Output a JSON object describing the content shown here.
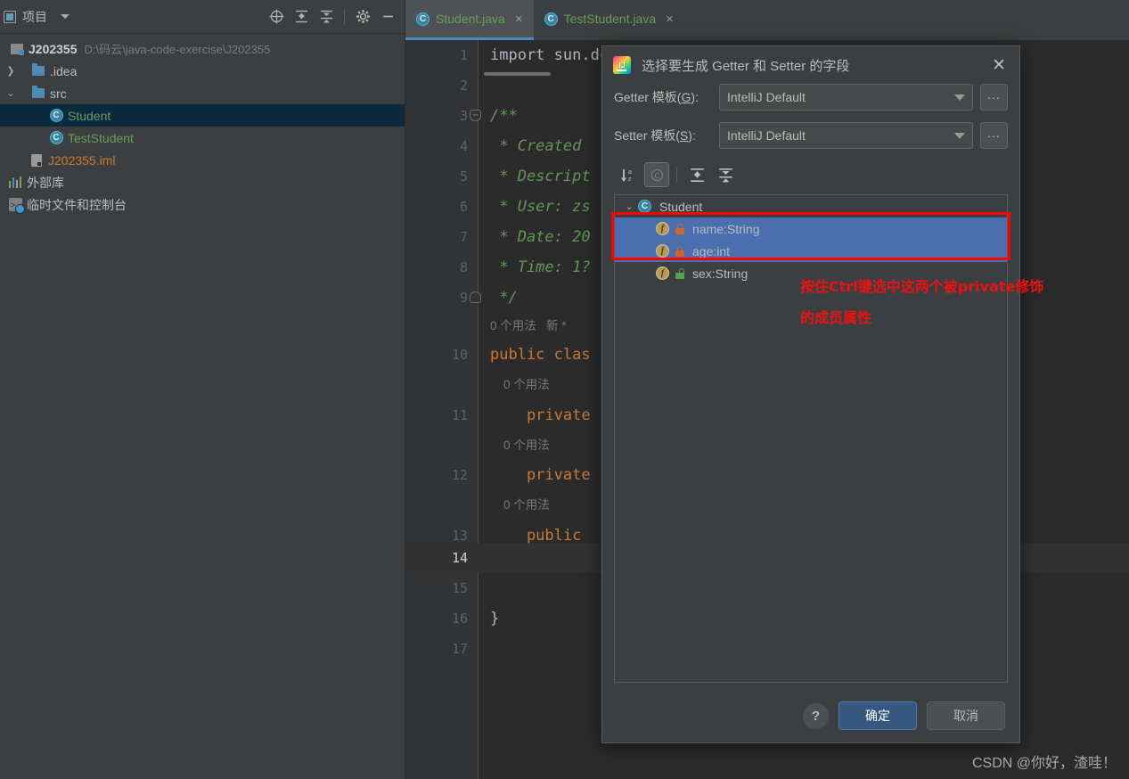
{
  "project_panel": {
    "title": "项目",
    "icons": {
      "project_icon": "project-view-icon",
      "dropdown": "chevron-down-icon",
      "locate": "crosshair-target-icon",
      "expand_all": "expand-all-icon",
      "collapse_all": "collapse-all-icon",
      "settings": "gear-icon",
      "hide": "minimize-icon"
    },
    "tree": [
      {
        "label": "J202355",
        "path": "D:\\码云\\java-code-exercise\\J202355",
        "icon": "module-icon",
        "indent": 0,
        "twist": "",
        "bold": true,
        "color": "normal",
        "selected": false
      },
      {
        "label": ".idea",
        "path": "",
        "icon": "folder-icon",
        "indent": 1,
        "twist": "collapsed",
        "bold": false,
        "color": "normal",
        "selected": false
      },
      {
        "label": "src",
        "path": "",
        "icon": "folder-icon",
        "indent": 1,
        "twist": "expanded",
        "bold": false,
        "color": "normal",
        "selected": false
      },
      {
        "label": "Student",
        "path": "",
        "icon": "java-class-icon",
        "indent": 2,
        "twist": "",
        "bold": false,
        "color": "green",
        "selected": true
      },
      {
        "label": "TestStudent",
        "path": "",
        "icon": "java-class-icon",
        "indent": 2,
        "twist": "",
        "bold": false,
        "color": "green",
        "selected": false
      },
      {
        "label": "J202355.iml",
        "path": "",
        "icon": "iml-file-icon",
        "indent": 1,
        "twist": "",
        "bold": false,
        "color": "red",
        "selected": false
      },
      {
        "label": "外部库",
        "path": "",
        "icon": "external-libraries-icon",
        "indent": 0,
        "twist": "",
        "bold": false,
        "color": "normal",
        "selected": false
      },
      {
        "label": "临时文件和控制台",
        "path": "",
        "icon": "scratches-consoles-icon",
        "indent": 0,
        "twist": "",
        "bold": false,
        "color": "normal",
        "selected": false
      }
    ]
  },
  "editor": {
    "tabs": [
      {
        "label": "Student.java",
        "active": true,
        "icon": "java-class-icon",
        "close": "×"
      },
      {
        "label": "TestStudent.java",
        "active": false,
        "icon": "java-class-icon",
        "close": "×"
      }
    ],
    "current_line": 14,
    "lines": [
      {
        "no": "1",
        "text": "import sun.dc.pr.Rasterizer;",
        "style": "plain",
        "fold": ""
      },
      {
        "no": "2",
        "text": "",
        "style": "plain",
        "fold": ""
      },
      {
        "no": "3",
        "text": "/**",
        "style": "comment",
        "fold": "open"
      },
      {
        "no": "4",
        "text": " * Created",
        "style": "comment",
        "fold": ""
      },
      {
        "no": "5",
        "text": " * Descript",
        "style": "comment",
        "fold": ""
      },
      {
        "no": "6",
        "text": " * User: zs",
        "style": "comment",
        "fold": ""
      },
      {
        "no": "7",
        "text": " * Date: 20",
        "style": "comment",
        "fold": ""
      },
      {
        "no": "8",
        "text": " * Time: 1?",
        "style": "comment",
        "fold": ""
      },
      {
        "no": "9",
        "text": " */",
        "style": "comment",
        "fold": "close"
      },
      {
        "no": "",
        "text": "0 个用法   新 *",
        "style": "hint",
        "fold": ""
      },
      {
        "no": "10",
        "text": "public clas",
        "style": "keyword",
        "fold": ""
      },
      {
        "no": "",
        "text": "    0 个用法",
        "style": "hint",
        "fold": ""
      },
      {
        "no": "11",
        "text": "    private",
        "style": "keyword",
        "fold": ""
      },
      {
        "no": "",
        "text": "    0 个用法",
        "style": "hint",
        "fold": ""
      },
      {
        "no": "12",
        "text": "    private",
        "style": "keyword",
        "fold": ""
      },
      {
        "no": "",
        "text": "    0 个用法",
        "style": "hint",
        "fold": ""
      },
      {
        "no": "13",
        "text": "    public",
        "style": "keyword",
        "fold": ""
      },
      {
        "no": "14",
        "text": "",
        "style": "plain",
        "fold": ""
      },
      {
        "no": "15",
        "text": "",
        "style": "plain",
        "fold": ""
      },
      {
        "no": "16",
        "text": "}",
        "style": "plain",
        "fold": ""
      },
      {
        "no": "17",
        "text": "",
        "style": "plain",
        "fold": ""
      }
    ]
  },
  "dialog": {
    "title": "选择要生成 Getter 和 Setter 的字段",
    "logo": "intellij-idea-logo-icon",
    "close_label": "✕",
    "getter_label_pre": "Getter 模板(",
    "getter_label_key": "G",
    "getter_label_post": "):",
    "setter_label_pre": "Setter 模板(",
    "setter_label_key": "S",
    "setter_label_post": "):",
    "getter_template": "IntelliJ Default",
    "setter_template": "IntelliJ Default",
    "dots_label": "...",
    "toolbar": {
      "sort_alpha": "sort-alphabetically-icon",
      "group_by_class": "group-by-class-icon",
      "expand_all": "expand-all-icon",
      "collapse_all": "collapse-all-icon"
    },
    "tree": {
      "class_name": "Student",
      "class_icon": "java-class-icon",
      "fields": [
        {
          "name": "name:String",
          "visibility": "private",
          "selected": true
        },
        {
          "name": "age:int",
          "visibility": "private",
          "selected": true
        },
        {
          "name": "sex:String",
          "visibility": "public",
          "selected": false
        }
      ]
    },
    "annotation_line1": "按住Ctrl键选中这两个被private修饰",
    "annotation_line2": "的成员属性",
    "footer": {
      "help_label": "?",
      "ok_label": "确定",
      "cancel_label": "取消"
    }
  },
  "watermark": "CSDN @你好，渣哇！"
}
